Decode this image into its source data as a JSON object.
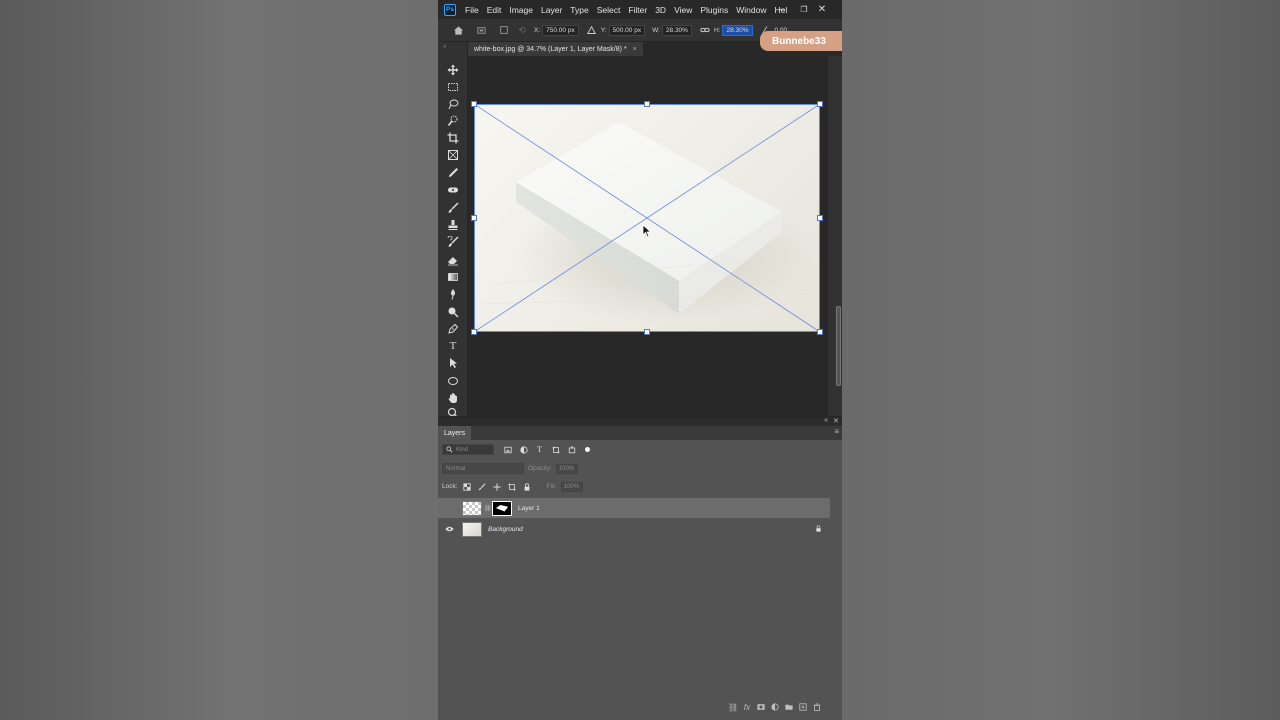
{
  "app": {
    "logo": "Ps"
  },
  "menu": {
    "items": [
      "File",
      "Edit",
      "Image",
      "Layer",
      "Type",
      "Select",
      "Filter",
      "3D",
      "View",
      "Plugins",
      "Window",
      "Hel"
    ]
  },
  "window_controls": {
    "minimize": "–",
    "restore": "❐",
    "close": "✕"
  },
  "options": {
    "x_label": "X:",
    "x_value": "750.00 px",
    "y_label": "Y:",
    "y_value": "500.00 px",
    "w_label": "W:",
    "w_value": "28.30%",
    "h_label": "H:",
    "h_value": "28.30%",
    "rotate_value": "0.00"
  },
  "watermark": {
    "text": "Bunnebe33"
  },
  "document": {
    "tab_title": "white-box.jpg @ 34.7% (Layer 1, Layer Mask/8) *",
    "close": "×"
  },
  "layers_panel": {
    "title": "Layers",
    "search_placeholder": "Kind",
    "blend_mode": "Normal",
    "opacity_label": "Opacity:",
    "opacity_value": "100%",
    "lock_label": "Lock:",
    "fill_label": "Fill:",
    "fill_value": "100%",
    "layers": [
      {
        "name": "Layer 1",
        "selected": true,
        "visible": false
      },
      {
        "name": "Background",
        "selected": false,
        "visible": true,
        "locked": true
      }
    ]
  },
  "colors": {
    "accent": "#31a8ff",
    "transform_line": "#6a8bdc",
    "watermark_bg": "#d6a084"
  },
  "icons": [
    "move-icon",
    "marquee-icon",
    "lasso-icon",
    "quick-select-icon",
    "crop-icon",
    "frame-icon",
    "eyedropper-icon",
    "healing-icon",
    "brush-icon",
    "stamp-icon",
    "history-brush-icon",
    "eraser-icon",
    "gradient-icon",
    "blur-icon",
    "dodge-icon",
    "pen-icon",
    "type-icon",
    "path-select-icon",
    "ellipse-icon",
    "hand-icon",
    "zoom-icon"
  ]
}
